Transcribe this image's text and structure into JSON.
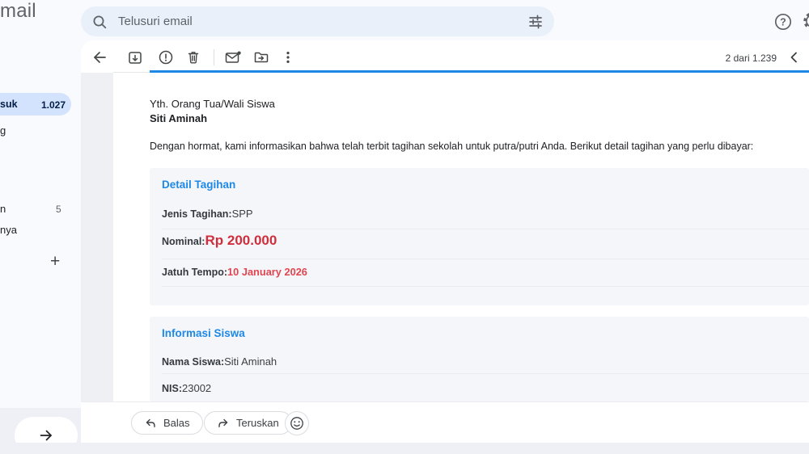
{
  "app": {
    "logo_visible_text": "mail"
  },
  "search": {
    "placeholder": "Telusuri email"
  },
  "topbar": {
    "icons": {
      "search": "magnifier",
      "filters": "tune-sliders",
      "help": "circle-question-mark",
      "settings": "gear (partially cut at screen edge)"
    }
  },
  "toolbar": {
    "pagination": "2 dari 1.239",
    "icons": {
      "back": "left-arrow",
      "archive": "box-with-down-arrow",
      "report_spam": "circle-exclamation",
      "delete": "trash-can",
      "mark_unread": "envelope-with-dot",
      "move_to": "folder-with-arrow",
      "more": "vertical-three-dots",
      "newer": "chevron-left"
    }
  },
  "sidebar": {
    "items": [
      {
        "label": "suk",
        "count": "1.027",
        "active": true
      },
      {
        "label": "g",
        "count": "",
        "active": false
      },
      {
        "label": "n",
        "count": "5",
        "active": false
      },
      {
        "label": "nya",
        "count": "",
        "active": false
      }
    ],
    "add_button": "+",
    "collapse_arrow_icon": "right-arrow"
  },
  "email": {
    "salutation": "Yth. Orang Tua/Wali Siswa",
    "recipient_name": "Siti Aminah",
    "intro": "Dengan hormat, kami informasikan bahwa telah terbit tagihan sekolah untuk putra/putri Anda. Berikut detail tagihan yang perlu dibayar:",
    "sections": [
      {
        "title": "Detail Tagihan",
        "rows": [
          {
            "label": "Jenis Tagihan:",
            "value": "SPP"
          },
          {
            "label": "Nominal:",
            "value": "Rp 200.000"
          },
          {
            "label": "Jatuh Tempo:",
            "value": "10 January 2026"
          }
        ]
      },
      {
        "title": "Informasi Siswa",
        "rows": [
          {
            "label": "Nama Siswa:",
            "value": "Siti Aminah"
          },
          {
            "label": "NIS:",
            "value": "23002"
          }
        ]
      }
    ]
  },
  "actions": {
    "reply_label": "Balas",
    "forward_label": "Teruskan",
    "emoji_icon": "smiley-face"
  },
  "colors": {
    "accent_blue": "#1e88e5",
    "danger_red_large": "#cf2f3c",
    "danger_red": "#e04550",
    "active_nav_pill": "#d3e3fd",
    "search_bar_bg": "#e9f0fa",
    "card_bg": "#ffffff",
    "section_box_bg": "#f5f6f9"
  }
}
